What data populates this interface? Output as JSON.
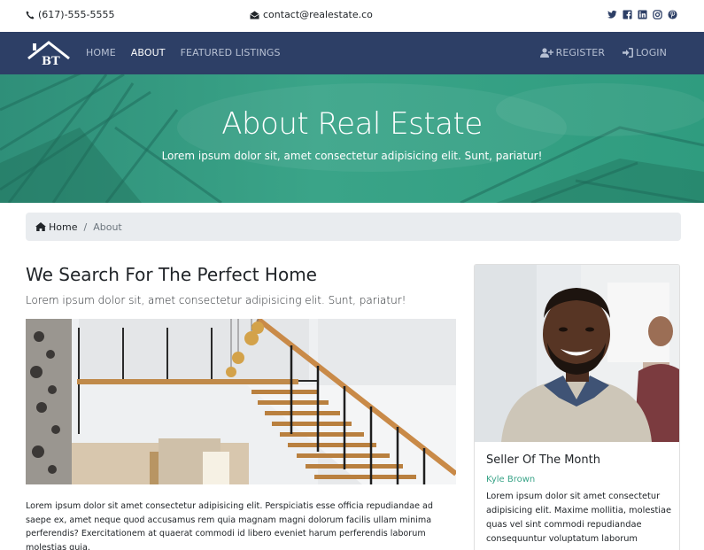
{
  "topbar": {
    "phone": "(617)-555-5555",
    "email": "contact@realestate.co",
    "social_icons": [
      "twitter-icon",
      "facebook-icon",
      "linkedin-icon",
      "instagram-icon",
      "pinterest-icon"
    ]
  },
  "navbar": {
    "logo_text": "BT",
    "links": [
      {
        "label": "HOME",
        "active": false
      },
      {
        "label": "ABOUT",
        "active": true
      },
      {
        "label": "FEATURED LISTINGS",
        "active": false
      }
    ],
    "register_label": "REGISTER",
    "login_label": "LOGIN"
  },
  "hero": {
    "title": "About Real Estate",
    "subtitle": "Lorem ipsum dolor sit, amet consectetur adipisicing elit. Sunt, pariatur!"
  },
  "breadcrumb": {
    "home": "Home",
    "separator": "/",
    "current": "About"
  },
  "main": {
    "title": "We Search For The Perfect Home",
    "subtitle": "Lorem ipsum dolor sit, amet consectetur adipisicing elit. Sunt, pariatur!",
    "body": "Lorem ipsum dolor sit amet consectetur adipisicing elit. Perspiciatis esse officia repudiandae ad saepe ex, amet neque quod accusamus rem quia magnam magni dolorum facilis ullam minima perferendis? Exercitationem at quaerat commodi id libero eveniet harum perferendis laborum molestias quia."
  },
  "seller_card": {
    "title": "Seller Of The Month",
    "name": "Kyle Brown",
    "text": "Lorem ipsum dolor sit amet consectetur adipisicing elit. Maxime mollitia, molestiae quas vel sint commodi repudiandae consequuntur voluptatum laborum"
  },
  "colors": {
    "navbar": "#2d3f66",
    "hero": "#3aa488",
    "accent_green": "#3aa488",
    "breadcrumb_bg": "#e9ecef"
  }
}
